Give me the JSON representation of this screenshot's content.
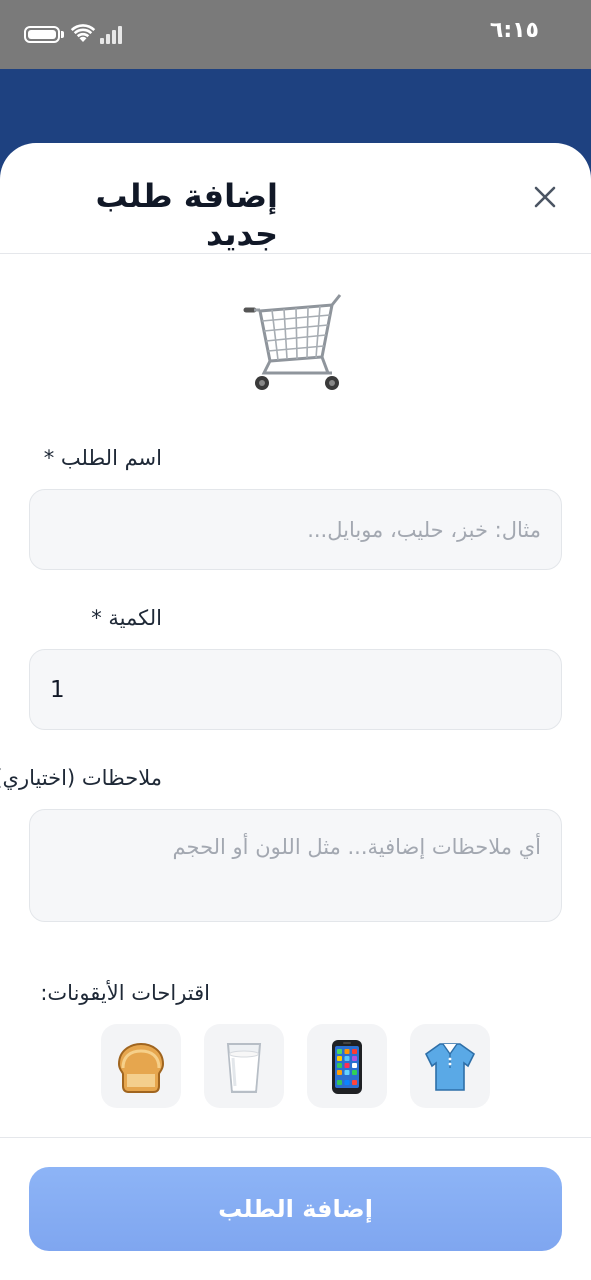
{
  "status_bar": {
    "time": "٦:١٥"
  },
  "sheet": {
    "title": "إضافة طلب جديد",
    "close_label": "إغلاق"
  },
  "form": {
    "name_label": "اسم الطلب *",
    "name_placeholder": "مثال: خبز، حليب، موبايل...",
    "name_value": "",
    "quantity_label": "الكمية *",
    "quantity_value": "1",
    "notes_label": "ملاحظات (اختياري)",
    "notes_placeholder": "أي ملاحظات إضافية... مثل اللون أو الحجم",
    "notes_value": ""
  },
  "suggestions": {
    "label": "اقتراحات الأيقونات:",
    "icons": [
      "bread-icon",
      "milk-glass-icon",
      "mobile-phone-icon",
      "shirt-icon"
    ]
  },
  "submit": {
    "label": "إضافة الطلب"
  },
  "colors": {
    "status_bar": "#7a7a7a",
    "backdrop": "#1e4180",
    "button": "#85acf3",
    "input_bg": "#f6f7f9"
  }
}
